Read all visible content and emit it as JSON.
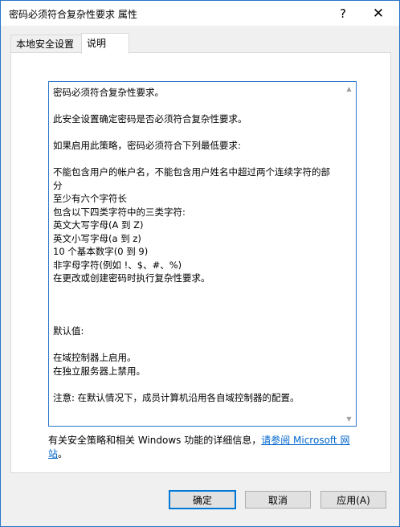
{
  "window": {
    "title": "密码必须符合复杂性要求 属性",
    "help_label": "?",
    "close_label": "✕"
  },
  "tabs": [
    {
      "label": "本地安全设置"
    },
    {
      "label": "说明"
    }
  ],
  "explain": {
    "text": "密码必须符合复杂性要求。\n\n此安全设置确定密码是否必须符合复杂性要求。\n\n如果启用此策略，密码必须符合下列最低要求:\n\n不能包含用户的帐户名，不能包含用户姓名中超过两个连续字符的部分\n至少有六个字符长\n包含以下四类字符中的三类字符:\n英文大写字母(A 到 Z)\n英文小写字母(a 到 z)\n10 个基本数字(0 到 9)\n非字母字符(例如 !、$、#、%)\n在更改或创建密码时执行复杂性要求。\n\n\n\n默认值:\n\n在域控制器上启用。\n在独立服务器上禁用。\n\n注意: 在默认情况下，成员计算机沿用各自域控制器的配置。"
  },
  "footer": {
    "info_prefix": "有关安全策略和相关 Windows 功能的详细信息，",
    "info_link": "请参阅 Microsoft 网站",
    "info_suffix": "。"
  },
  "buttons": {
    "ok": "确定",
    "cancel": "取消",
    "apply": "应用(A)"
  }
}
